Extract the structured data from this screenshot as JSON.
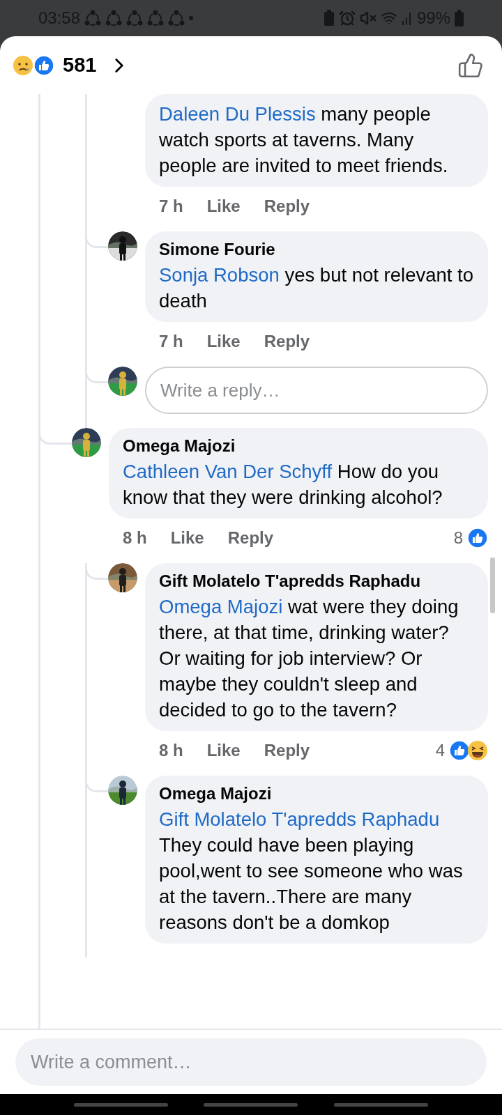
{
  "status_bar": {
    "time": "03:58",
    "battery": "99%"
  },
  "header": {
    "reactions": [
      {
        "kind": "sad"
      },
      {
        "kind": "like"
      }
    ],
    "count": "581"
  },
  "thread": [
    {
      "children": [
        {
          "mention": "Daleen Du Plessis",
          "text": "many people watch sports at taverns. Many people are invited to meet friends.",
          "time": "7 h",
          "like": "Like",
          "reply": "Reply"
        },
        {
          "author": "Simone Fourie",
          "mention": "Sonja Robson",
          "text": "yes but not relevant to death",
          "time": "7 h",
          "like": "Like",
          "reply": "Reply"
        }
      ],
      "reply_box": {
        "placeholder": "Write a reply…"
      }
    },
    {
      "author": "Omega Majozi",
      "mention": "Cathleen Van Der Schyff",
      "text": "How do you know that they were drinking alcohol?",
      "time": "8 h",
      "like": "Like",
      "reply": "Reply",
      "reactions": {
        "count": "8",
        "icons": [
          {
            "kind": "like"
          }
        ]
      },
      "children": [
        {
          "author": "Gift Molatelo T'apredds Raphadu",
          "mention": "Omega Majozi",
          "text": "wat were they doing there, at that time, drinking water? Or waiting for job interview? Or maybe they couldn't sleep and decided to go to the tavern?",
          "time": "8 h",
          "like": "Like",
          "reply": "Reply",
          "reactions": {
            "count": "4",
            "icons": [
              {
                "kind": "like"
              },
              {
                "kind": "haha"
              }
            ]
          }
        },
        {
          "author": "Omega Majozi",
          "mention": "Gift Molatelo T'apredds Raphadu",
          "text": "They could have been playing pool,went to see someone who was at the tavern..There are many reasons don't be a domkop"
        }
      ]
    }
  ],
  "composer": {
    "placeholder": "Write a comment…"
  }
}
